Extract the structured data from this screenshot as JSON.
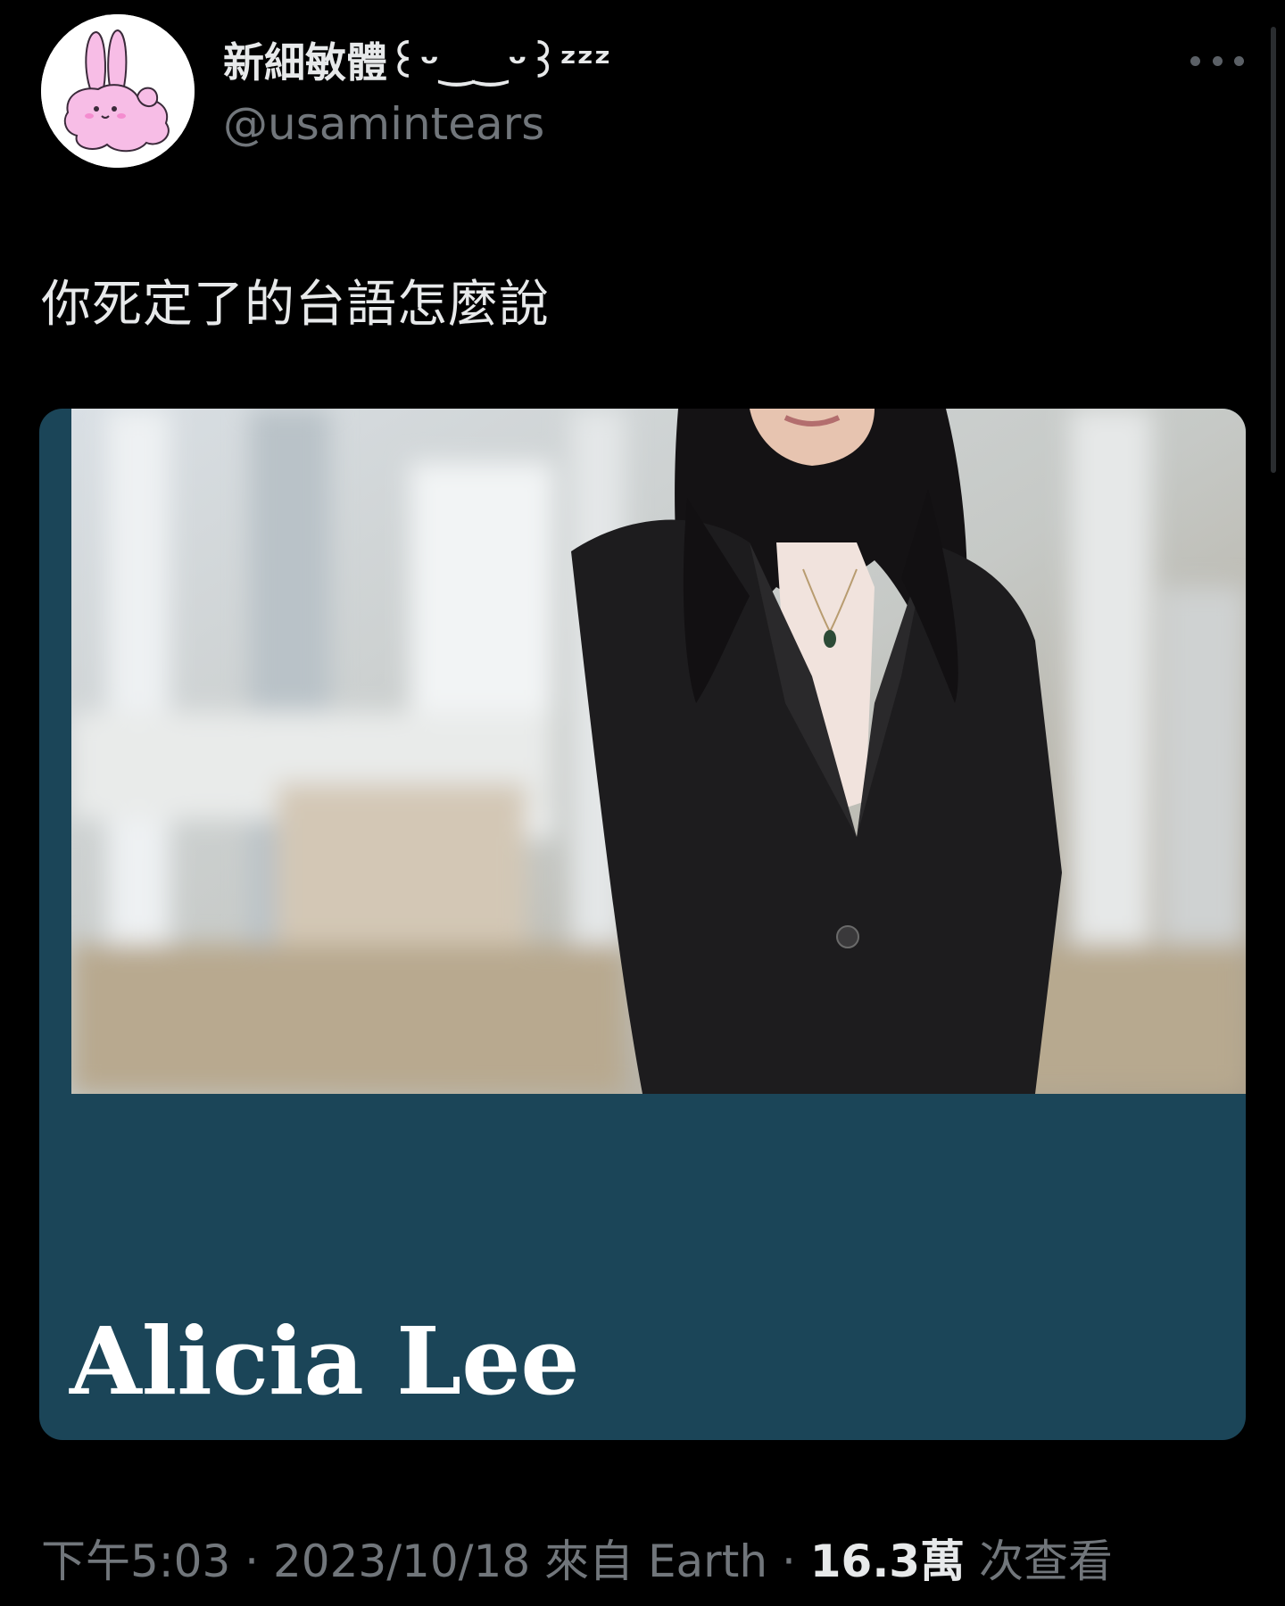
{
  "tweet": {
    "author": {
      "display_name": "新細敏體꒰ᵕ‿‿ᵕ꒱ᶻᶻᶻ",
      "handle": "@usamintears",
      "avatar_icon": "pink-bunny-avatar"
    },
    "more_icon": "more-horizontal-icon",
    "text": "你死定了的台語怎麼說",
    "media": {
      "name_text": "Alicia Lee",
      "card_color": "#1b4558"
    },
    "meta": {
      "time": "下午5:03",
      "separator": " · ",
      "date": "2023/10/18",
      "source": "來自 Earth",
      "views_count": "16.3萬",
      "views_label": "次查看"
    }
  },
  "colors": {
    "background": "#000000",
    "primary_text": "#e7e9ea",
    "secondary_text": "#71767b"
  }
}
